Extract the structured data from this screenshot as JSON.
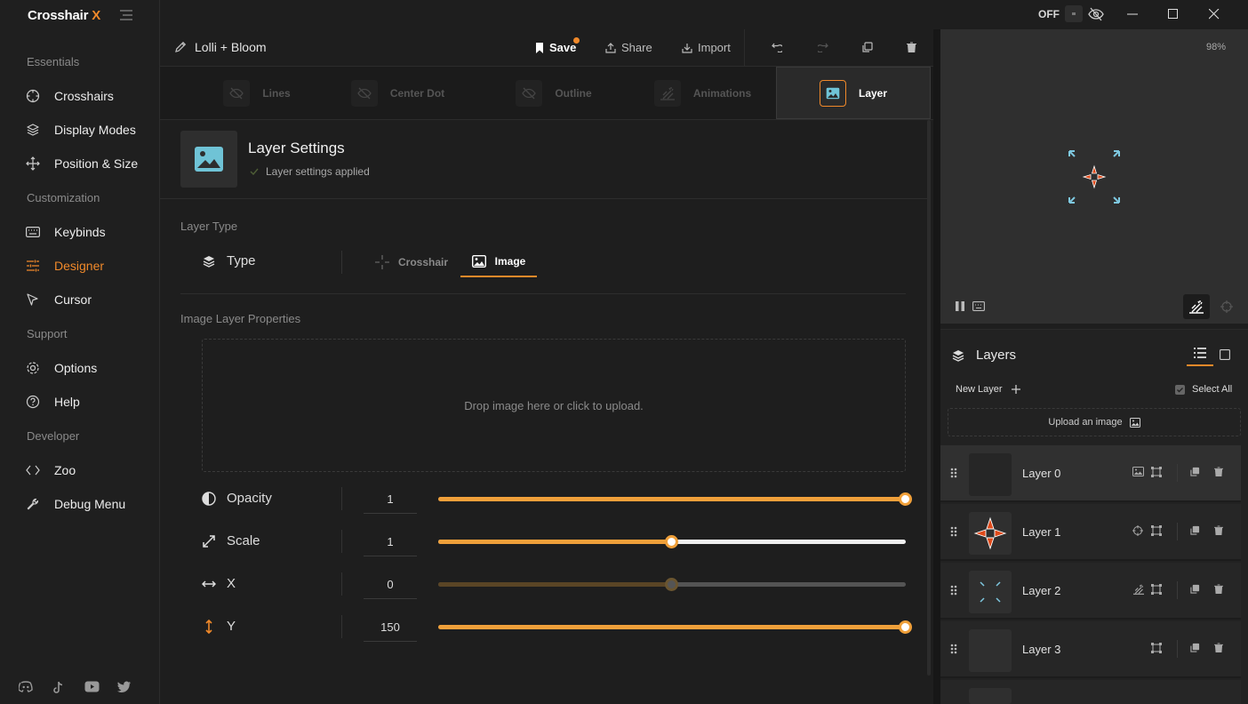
{
  "app": {
    "logo_main": "Crosshair",
    "logo_accent": "X",
    "overlay_state": "OFF"
  },
  "sidebar": {
    "sections": [
      {
        "label": "Essentials"
      },
      {
        "label": "Customization"
      },
      {
        "label": "Support"
      },
      {
        "label": "Developer"
      }
    ],
    "items": [
      {
        "label": "Crosshairs",
        "icon": "crosshair-icon"
      },
      {
        "label": "Display Modes",
        "icon": "layers-icon"
      },
      {
        "label": "Position & Size",
        "icon": "move-icon"
      },
      {
        "label": "Keybinds",
        "icon": "keyboard-icon"
      },
      {
        "label": "Designer",
        "icon": "sliders-icon",
        "active": true
      },
      {
        "label": "Cursor",
        "icon": "cursor-icon"
      },
      {
        "label": "Options",
        "icon": "gear-icon"
      },
      {
        "label": "Help",
        "icon": "help-icon"
      },
      {
        "label": "Zoo",
        "icon": "code-icon"
      },
      {
        "label": "Debug Menu",
        "icon": "wrench-icon"
      }
    ],
    "social": [
      "discord-icon",
      "tiktok-icon",
      "youtube-icon",
      "twitter-icon"
    ]
  },
  "toolbar": {
    "title": "Lolli + Bloom",
    "save": "Save",
    "share": "Share",
    "import": "Import"
  },
  "tabs": [
    {
      "label": "Lines"
    },
    {
      "label": "Center Dot"
    },
    {
      "label": "Outline"
    },
    {
      "label": "Animations"
    },
    {
      "label": "Layer",
      "active": true
    }
  ],
  "layer_settings": {
    "title": "Layer Settings",
    "status": "Layer settings applied",
    "type_section": "Layer Type",
    "type_label": "Type",
    "type_options": [
      "Crosshair",
      "Image"
    ],
    "type_selected": "Image",
    "image_section": "Image Layer Properties",
    "dropzone": "Drop image here or click to upload.",
    "properties": [
      {
        "label": "Opacity",
        "value": "1",
        "fill": 1.0
      },
      {
        "label": "Scale",
        "value": "1",
        "fill": 0.5
      },
      {
        "label": "X",
        "value": "0",
        "fill": 0.5
      },
      {
        "label": "Y",
        "value": "150",
        "fill": 1.0
      }
    ]
  },
  "preview": {
    "zoom": "98%"
  },
  "layers_panel": {
    "title": "Layers",
    "new_layer": "New Layer",
    "select_all": "Select All",
    "upload": "Upload an image",
    "layers": [
      {
        "name": "Layer 0",
        "selected": true
      },
      {
        "name": "Layer 1"
      },
      {
        "name": "Layer 2"
      },
      {
        "name": "Layer 3"
      }
    ]
  },
  "colors": {
    "accent": "#f0892a",
    "slider": "#f0a03a",
    "icon_blue": "#6fc3d6",
    "background": "#1e1e1e"
  }
}
